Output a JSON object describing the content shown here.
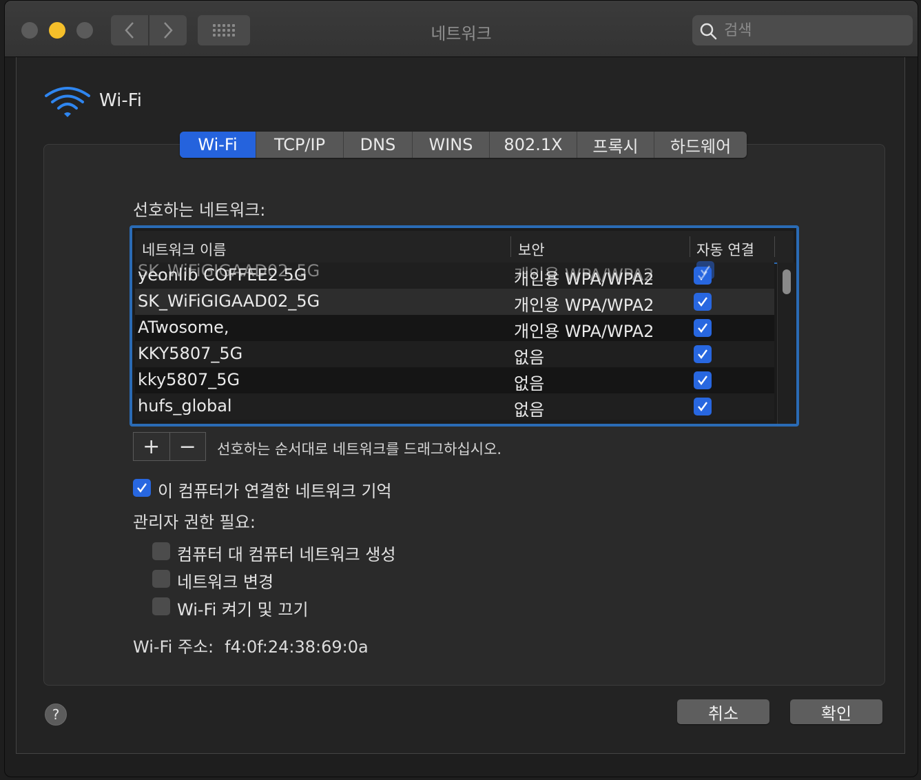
{
  "window": {
    "title": "네트워크",
    "search_placeholder": "검색",
    "nav_back": "‹",
    "nav_forward": "›"
  },
  "header": {
    "service_name": "Wi-Fi",
    "icon": "wifi-icon"
  },
  "tabs": [
    {
      "label": "Wi-Fi",
      "active": true
    },
    {
      "label": "TCP/IP",
      "active": false
    },
    {
      "label": "DNS",
      "active": false
    },
    {
      "label": "WINS",
      "active": false
    },
    {
      "label": "802.1X",
      "active": false
    },
    {
      "label": "프록시",
      "active": false
    },
    {
      "label": "하드웨어",
      "active": false
    }
  ],
  "preferred": {
    "label": "선호하는 네트워크:",
    "columns": {
      "name": "네트워크 이름",
      "security": "보안",
      "auto": "자동 연결"
    },
    "dragging": {
      "name": "SK_WiFiGIGAAD02_5G",
      "security": "개인용 WPA/WPA2",
      "auto": true
    },
    "rows": [
      {
        "name": "yeonlib COFFEE2 5G",
        "security": "개인용 WPA/WPA2",
        "auto": true
      },
      {
        "name": "SK_WiFiGIGAAD02_5G",
        "security": "개인용 WPA/WPA2",
        "auto": true
      },
      {
        "name": "ATwosome,",
        "security": "개인용 WPA/WPA2",
        "auto": true
      },
      {
        "name": "KKY5807_5G",
        "security": "없음",
        "auto": true
      },
      {
        "name": "kky5807_5G",
        "security": "없음",
        "auto": true
      },
      {
        "name": "hufs_global",
        "security": "없음",
        "auto": true
      }
    ],
    "add_label": "+",
    "remove_label": "−",
    "drag_hint": "선호하는 순서대로 네트워크를 드래그하십시오."
  },
  "options": {
    "remember": {
      "label": "이 컴퓨터가 연결한 네트워크 기억",
      "checked": true
    },
    "admin_label": "관리자 권한 필요:",
    "admin_items": [
      {
        "label": "컴퓨터 대 컴퓨터 네트워크 생성",
        "checked": false
      },
      {
        "label": "네트워크 변경",
        "checked": false
      },
      {
        "label": "Wi-Fi 켜기 및 끄기",
        "checked": false
      }
    ]
  },
  "address": {
    "label": "Wi-Fi 주소:",
    "value": "f4:0f:24:38:69:0a"
  },
  "footer": {
    "help": "?",
    "cancel": "취소",
    "ok": "확인"
  },
  "colors": {
    "accent": "#2563dd",
    "table_focus": "#2a6bb5",
    "traffic_yellow": "#f5bf2a"
  }
}
